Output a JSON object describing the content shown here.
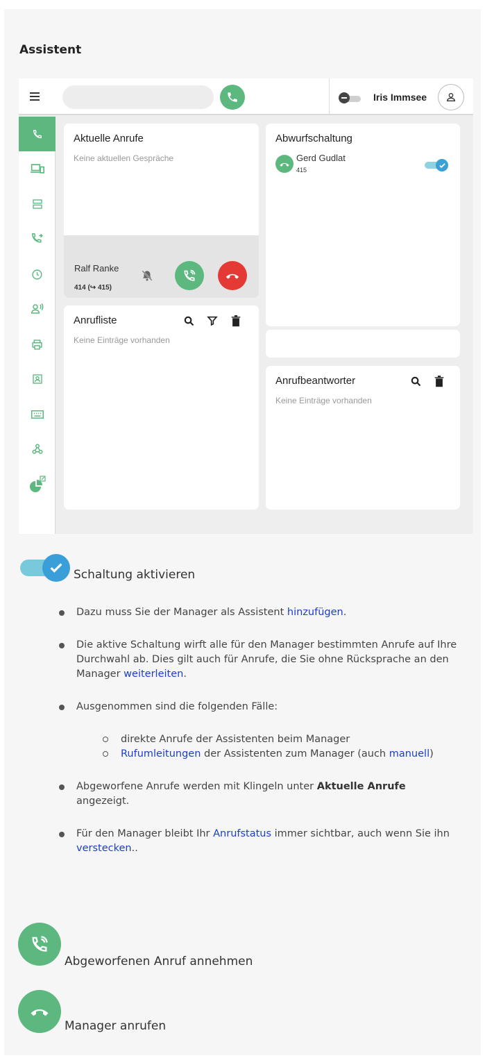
{
  "doc": {
    "title": "Assistent"
  },
  "app": {
    "search": {
      "placeholder": "",
      "value": ""
    },
    "user": {
      "name": "Iris Immsee"
    },
    "sidebar": {
      "items": [
        {
          "name": "phone-icon",
          "active": true
        },
        {
          "name": "devices-icon",
          "active": false
        },
        {
          "name": "server-icon",
          "active": false
        },
        {
          "name": "call-forward-icon",
          "active": false
        },
        {
          "name": "clock-icon",
          "active": false
        },
        {
          "name": "voicemail-person-icon",
          "active": false
        },
        {
          "name": "printer-icon",
          "active": false
        },
        {
          "name": "contacts-icon",
          "active": false
        },
        {
          "name": "keyboard-icon",
          "active": false
        },
        {
          "name": "webhook-icon",
          "active": false
        },
        {
          "name": "pie-chart-external-icon",
          "active": false
        }
      ]
    },
    "current_calls": {
      "title": "Aktuelle Anrufe",
      "empty": "Keine aktuellen Gespräche",
      "incoming": {
        "name": "Ralf Ranke",
        "number": "414 (↪ 415)"
      }
    },
    "call_list": {
      "title": "Anrufliste",
      "empty": "Keine Einträge vorhanden"
    },
    "deflection": {
      "title": "Abwurfschaltung",
      "contact": {
        "name": "Gerd Gudlat",
        "number": "415"
      },
      "enabled": true
    },
    "answering_machine": {
      "title": "Anrufbeantworter",
      "empty": "Keine Einträge vorhanden"
    },
    "colors": {
      "green": "#5cb87e",
      "red": "#e53935",
      "blue": "#3a9fd8",
      "link": "#1a3dcc"
    }
  },
  "content": {
    "toggle_label": "Schaltung aktivieren",
    "bullets": {
      "b1": {
        "pre": "Dazu muss Sie der Manager als Assistent ",
        "link": "hinzufügen",
        "post": "."
      },
      "b2": {
        "pre": "Die aktive Schaltung wirft alle für den Manager bestimmten Anrufe auf Ihre Durchwahl ab. Dies gilt auch für Anrufe, die Sie ohne Rücksprache an den Manager ",
        "link": "weiterleiten",
        "post": "."
      },
      "b3": {
        "text": "Ausgenommen sind die folgenden Fälle:",
        "sub1": "direkte Anrufe der Assistenten beim Manager",
        "sub2": {
          "link1": "Rufumleitungen",
          "mid": " der Assistenten zum Manager (auch ",
          "link2": "manuell",
          "post": ")"
        }
      },
      "b4": {
        "pre": "Abgeworfene Anrufe werden mit Klingeln unter ",
        "bold": "Aktuelle Anrufe",
        "post": " angezeigt."
      },
      "b5": {
        "pre": "Für den Manager bleibt Ihr ",
        "link1": "Anrufstatus",
        "mid": " immer sichtbar, auch wenn Sie ihn ",
        "link2": "verstecken",
        "post": ".."
      }
    },
    "accept_label": "Abgeworfenen Anruf annehmen",
    "call_manager_label": "Manager anrufen"
  }
}
